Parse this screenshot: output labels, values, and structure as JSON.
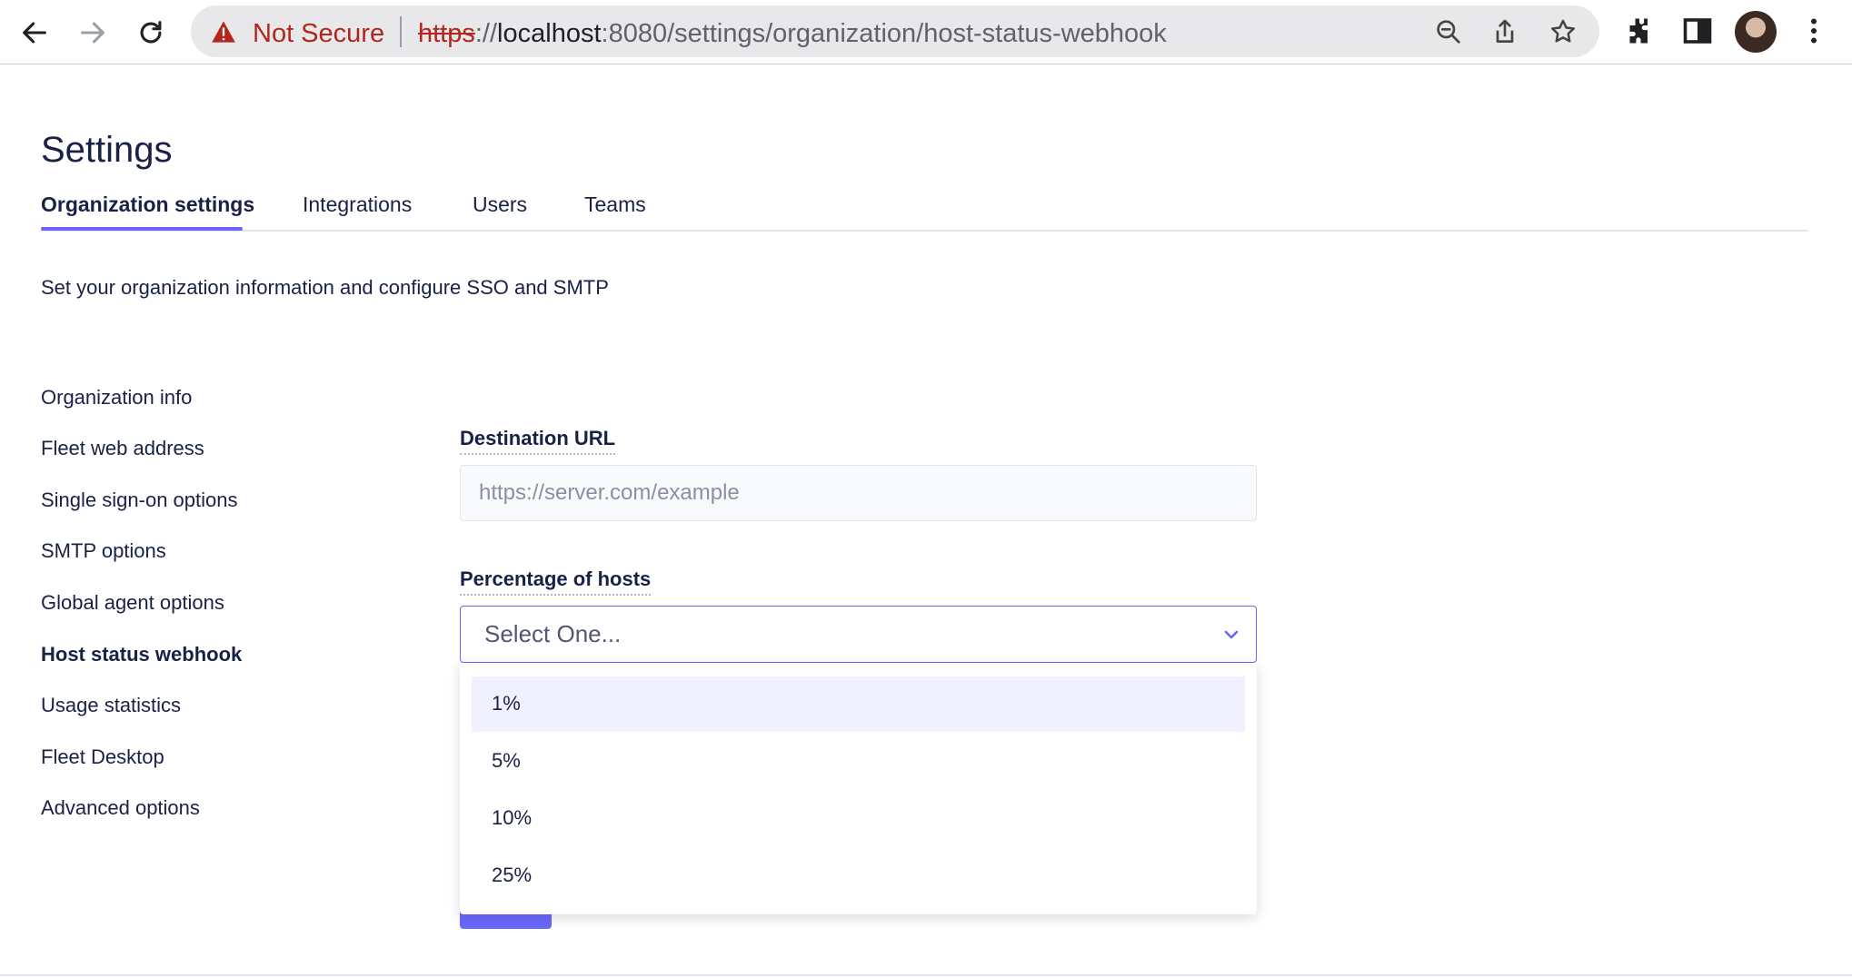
{
  "browser": {
    "security_label": "Not Secure",
    "url_scheme": "https",
    "url_sep": "://",
    "url_host": "localhost",
    "url_rest": ":8080/settings/organization/host-status-webhook",
    "icons": [
      "back-icon",
      "forward-icon",
      "reload-icon",
      "warning-icon",
      "zoom-out-icon",
      "share-icon",
      "star-icon",
      "extensions-icon",
      "side-panel-icon",
      "avatar",
      "menu-icon"
    ]
  },
  "page": {
    "title": "Settings",
    "description": "Set your organization information and configure SSO and SMTP"
  },
  "tabs": [
    {
      "label": "Organization settings",
      "active": true
    },
    {
      "label": "Integrations",
      "active": false
    },
    {
      "label": "Users",
      "active": false
    },
    {
      "label": "Teams",
      "active": false
    }
  ],
  "sidebar": {
    "items": [
      {
        "label": "Organization info"
      },
      {
        "label": "Fleet web address"
      },
      {
        "label": "Single sign-on options"
      },
      {
        "label": "SMTP options"
      },
      {
        "label": "Global agent options"
      },
      {
        "label": "Host status webhook",
        "active": true
      },
      {
        "label": "Usage statistics"
      },
      {
        "label": "Fleet Desktop"
      },
      {
        "label": "Advanced options"
      }
    ]
  },
  "form": {
    "destination_label": "Destination URL",
    "destination_placeholder": "https://server.com/example",
    "destination_value": "",
    "percentage_label": "Percentage of hosts",
    "percentage_selected": "Select One...",
    "percentage_options": [
      "1%",
      "5%",
      "10%",
      "25%"
    ]
  },
  "colors": {
    "accent": "#6a67fe",
    "text": "#192147",
    "warning": "#b3261e",
    "option_highlight": "#f1f0ff"
  }
}
